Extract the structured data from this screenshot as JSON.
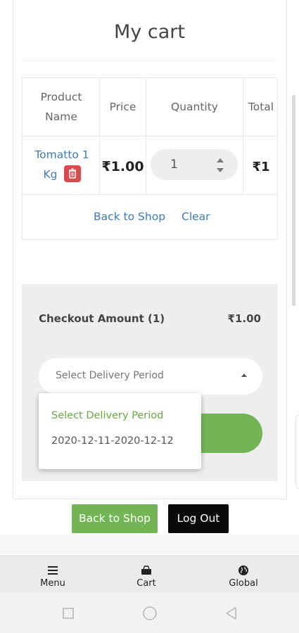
{
  "page": {
    "title": "My cart"
  },
  "table": {
    "headers": {
      "product": "Product Name",
      "price": "Price",
      "quantity": "Quantity",
      "total": "Total"
    },
    "rows": [
      {
        "product": "Tomatto 1 Kg",
        "price": "₹1.00",
        "quantity": "1",
        "total": "₹1"
      }
    ],
    "links": {
      "back_to_shop": "Back to Shop",
      "clear": "Clear"
    }
  },
  "checkout": {
    "label": "Checkout Amount (1)",
    "amount": "₹1.00",
    "select_placeholder": "Select Delivery Period"
  },
  "dropdown": {
    "options": [
      "Select Delivery Period",
      "2020-12-11-2020-12-12"
    ],
    "active_color": "#6aa64a"
  },
  "buttons": {
    "back_to_shop": "Back to Shop",
    "logout": "Log Out"
  },
  "nav": [
    {
      "label": "Menu",
      "icon": "menu-icon"
    },
    {
      "label": "Cart",
      "icon": "cart-icon"
    },
    {
      "label": "Global",
      "icon": "globe-icon"
    }
  ],
  "colors": {
    "accent_green": "#72b555",
    "link_blue": "#3d7bb8",
    "danger_red": "#e0474c"
  }
}
